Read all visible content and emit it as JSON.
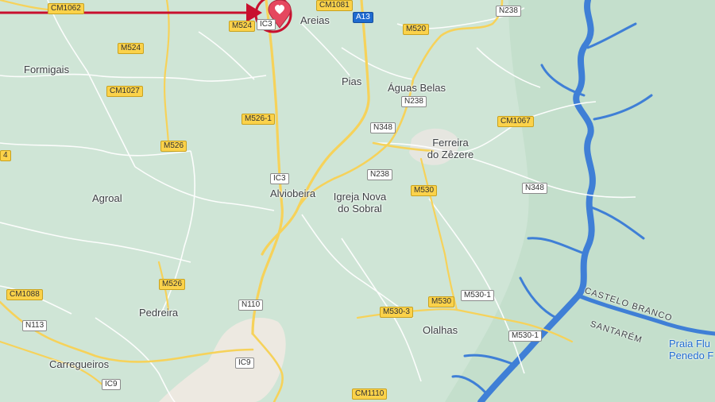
{
  "map": {
    "colors": {
      "land": "#cfe5d6",
      "urban": "#ede9e1",
      "water": "#3f7fd6",
      "major_road": "#f6d25a",
      "minor_road": "#ffffff",
      "marker": "#e5485f",
      "annotation": "#c8102e"
    },
    "places": {
      "formigais": "Formigais",
      "areias": "Areias",
      "pias": "Pias",
      "aguas_belas": "Águas Belas",
      "ferreira_1": "Ferreira",
      "ferreira_2": "do Zêzere",
      "agroal": "Agroal",
      "alviobeira": "Alviobeira",
      "igreja_1": "Igreja Nova",
      "igreja_2": "do Sobral",
      "pedreira": "Pedreira",
      "olalhas": "Olalhas",
      "carregueiros": "Carregueiros",
      "praia_1": "Praia Flu",
      "praia_2": "Penedo F"
    },
    "roads": {
      "cm1062": "CM1062",
      "ic3_top": "IC3",
      "m524_top": "M524",
      "cm1081": "CM1081",
      "a13": "A13",
      "n238_top": "N238",
      "m520": "M520",
      "m524_mid": "M524",
      "cm1027": "CM1027",
      "n238_mid": "N238",
      "m526_1": "M526-1",
      "n348_mid": "N348",
      "cm1067": "CM1067",
      "m526_left": "M526",
      "edge_4": "4",
      "ic3_mid": "IC3",
      "n238_low": "N238",
      "m530_a": "M530",
      "n348_right": "N348",
      "m526_low": "M526",
      "cm1088": "CM1088",
      "m530_b": "M530",
      "m530_1_a": "M530-1",
      "n110": "N110",
      "m530_3": "M530-3",
      "n113": "N113",
      "m530_1_b": "M530-1",
      "ic9_mid": "IC9",
      "ic9_low": "IC9",
      "cm1110": "CM1110"
    },
    "water": {
      "castelo_branco": "CASTELO BRANCO",
      "santarem": "SANTARÉM"
    },
    "marker": {
      "icon": "heart-map-pin-icon"
    },
    "annotation": {
      "icon": "red-arrow-annotation"
    }
  }
}
